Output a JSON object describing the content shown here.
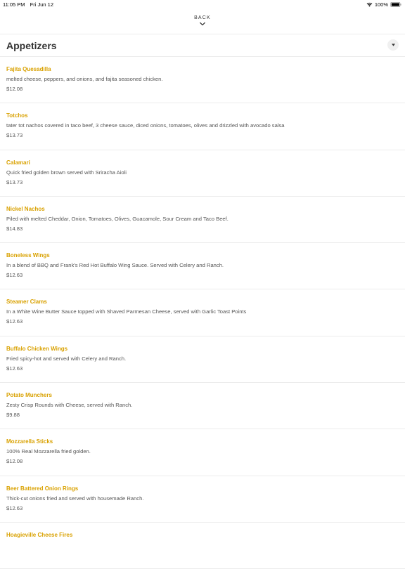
{
  "status": {
    "time": "11:05 PM",
    "date": "Fri Jun 12",
    "battery": "100%"
  },
  "nav": {
    "back_label": "BACK"
  },
  "section": {
    "title": "Appetizers"
  },
  "colors": {
    "accent": "#d9a100",
    "text": "#555555"
  },
  "items": [
    {
      "name": "Fajita Quesadilla",
      "desc": "melted cheese, peppers, and onions, and fajita seasoned chicken.",
      "price": "$12.08"
    },
    {
      "name": "Totchos",
      "desc": "tater tot nachos covered in taco beef, 3 cheese sauce, diced onions, tomatoes, olives and drizzled with avocado salsa",
      "price": "$13.73"
    },
    {
      "name": "Calamari",
      "desc": "Quick fried golden brown served with Sriracha Aioli",
      "price": "$13.73"
    },
    {
      "name": "Nickel Nachos",
      "desc": "Piled with melted Cheddar, Onion, Tomatoes, Olives, Guacamole, Sour Cream and Taco Beef.",
      "price": "$14.83"
    },
    {
      "name": "Boneless Wings",
      "desc": "In a blend of BBQ and Frank's Red Hot Buffalo Wing Sauce. Served with Celery and Ranch.",
      "price": "$12.63"
    },
    {
      "name": "Steamer Clams",
      "desc": "In a White Wine Butter Sauce topped with Shaved Parmesan Cheese, served with Garlic Toast Points",
      "price": "$12.63"
    },
    {
      "name": "Buffalo Chicken Wings",
      "desc": "Fried spicy-hot and served with Celery and Ranch.",
      "price": "$12.63"
    },
    {
      "name": "Potato Munchers",
      "desc": "Zesty Crisp Rounds with Cheese, served with Ranch.",
      "price": "$9.88"
    },
    {
      "name": "Mozzarella Sticks",
      "desc": "100% Real Mozzarella fried golden.",
      "price": "$12.08"
    },
    {
      "name": "Beer Battered Onion Rings",
      "desc": "Thick-cut onions fried and served with housemade Ranch.",
      "price": "$12.63"
    },
    {
      "name": "Hoagieville Cheese Fires",
      "desc": "",
      "price": ""
    }
  ]
}
